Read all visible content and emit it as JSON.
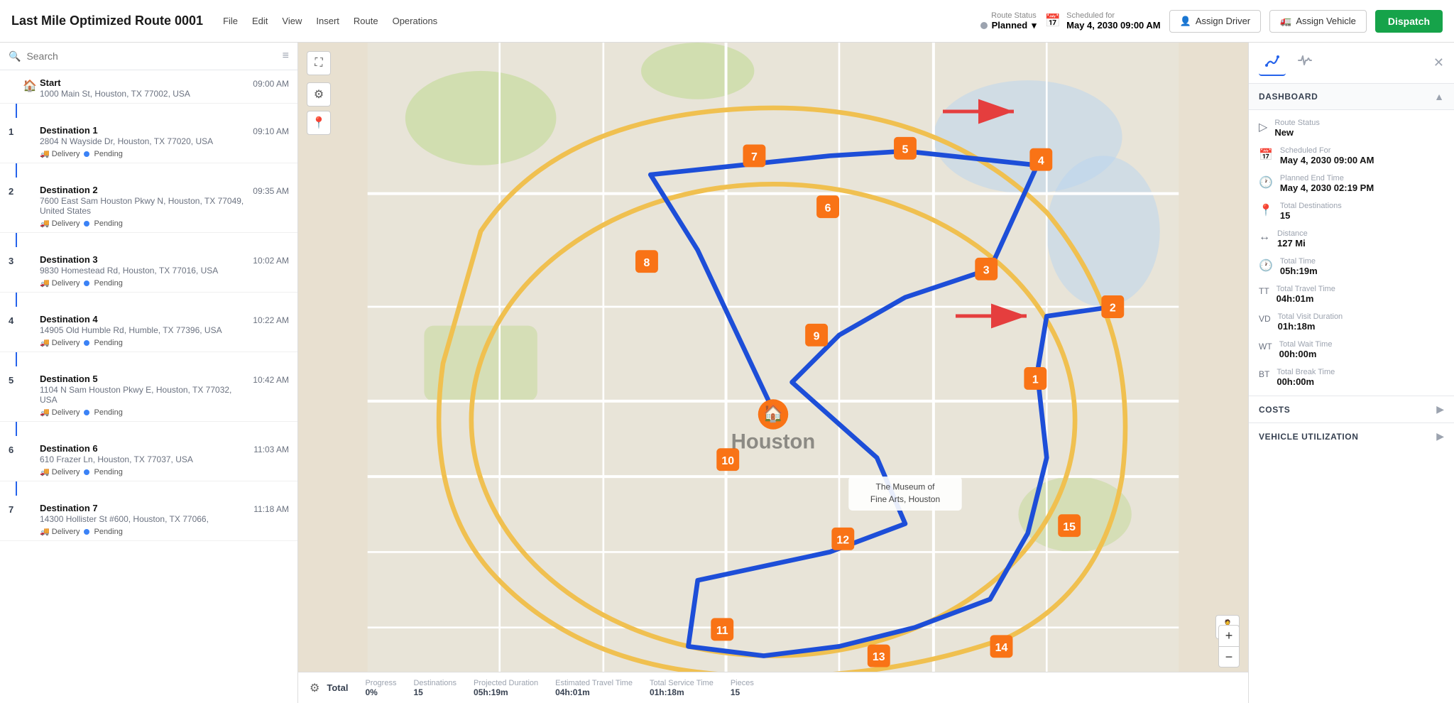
{
  "topbar": {
    "title": "Last Mile Optimized Route 0001",
    "menus": [
      "File",
      "Edit",
      "View",
      "Insert",
      "Route",
      "Operations"
    ],
    "route_status_label": "Route Status",
    "route_status_value": "Planned",
    "scheduled_label": "Scheduled for",
    "scheduled_value": "May 4, 2030 09:00 AM",
    "assign_driver_label": "Assign Driver",
    "assign_vehicle_label": "Assign Vehicle",
    "dispatch_label": "Dispatch"
  },
  "sidebar": {
    "search_placeholder": "Search",
    "stops": [
      {
        "number": "",
        "name": "Start",
        "address": "1000 Main St, Houston, TX 77002, USA",
        "time": "09:00 AM",
        "is_start": true,
        "tags": []
      },
      {
        "number": "1",
        "name": "Destination 1",
        "address": "2804 N Wayside Dr, Houston, TX 77020, USA",
        "time": "09:10 AM",
        "is_start": false,
        "tags": [
          "Delivery",
          "Pending"
        ]
      },
      {
        "number": "2",
        "name": "Destination 2",
        "address": "7600 East Sam Houston Pkwy N, Houston, TX 77049, United States",
        "time": "09:35 AM",
        "is_start": false,
        "tags": [
          "Delivery",
          "Pending"
        ]
      },
      {
        "number": "3",
        "name": "Destination 3",
        "address": "9830 Homestead Rd, Houston, TX 77016, USA",
        "time": "10:02 AM",
        "is_start": false,
        "tags": [
          "Delivery",
          "Pending"
        ]
      },
      {
        "number": "4",
        "name": "Destination 4",
        "address": "14905 Old Humble Rd, Humble, TX 77396, USA",
        "time": "10:22 AM",
        "is_start": false,
        "tags": [
          "Delivery",
          "Pending"
        ]
      },
      {
        "number": "5",
        "name": "Destination 5",
        "address": "1104 N Sam Houston Pkwy E, Houston, TX 77032, USA",
        "time": "10:42 AM",
        "is_start": false,
        "tags": [
          "Delivery",
          "Pending"
        ]
      },
      {
        "number": "6",
        "name": "Destination 6",
        "address": "610 Frazer Ln, Houston, TX 77037, USA",
        "time": "11:03 AM",
        "is_start": false,
        "tags": [
          "Delivery",
          "Pending"
        ]
      },
      {
        "number": "7",
        "name": "Destination 7",
        "address": "14300 Hollister St #600, Houston, TX 77066,",
        "time": "11:18 AM",
        "is_start": false,
        "tags": [
          "Delivery",
          "Pending"
        ]
      }
    ]
  },
  "map": {
    "expand_label": "⛶",
    "gear_label": "⚙",
    "pin_label": "📍",
    "zoom_in_label": "+",
    "zoom_out_label": "−"
  },
  "bottom_bar": {
    "gear_icon": "⚙",
    "total_label": "Total",
    "stats": [
      {
        "label": "Progress",
        "value": "0%"
      },
      {
        "label": "Destinations",
        "value": "15"
      },
      {
        "label": "Projected Duration",
        "value": "05h:19m"
      },
      {
        "label": "Estimated Travel Time",
        "value": "04h:01m"
      },
      {
        "label": "Total Service Time",
        "value": "01h:18m"
      },
      {
        "label": "Pieces",
        "value": "15"
      }
    ]
  },
  "panel": {
    "dashboard_label": "DASHBOARD",
    "close_label": "✕",
    "route_status_label": "Route Status",
    "route_status_value": "New",
    "scheduled_for_label": "Scheduled For",
    "scheduled_for_value": "May 4, 2030 09:00 AM",
    "planned_end_label": "Planned End Time",
    "planned_end_value": "May 4, 2030 02:19 PM",
    "total_destinations_label": "Total Destinations",
    "total_destinations_value": "15",
    "distance_label": "Distance",
    "distance_value": "127 Mi",
    "total_time_label": "Total Time",
    "total_time_value": "05h:19m",
    "total_travel_label": "Total Travel Time",
    "total_travel_value": "04h:01m",
    "total_visit_label": "Total Visit Duration",
    "total_visit_value": "01h:18m",
    "total_wait_label": "Total Wait Time",
    "total_wait_value": "00h:00m",
    "total_break_label": "Total Break Time",
    "total_break_value": "00h:00m",
    "costs_label": "COSTS",
    "vehicle_label": "VEHICLE UTILIZATION"
  }
}
